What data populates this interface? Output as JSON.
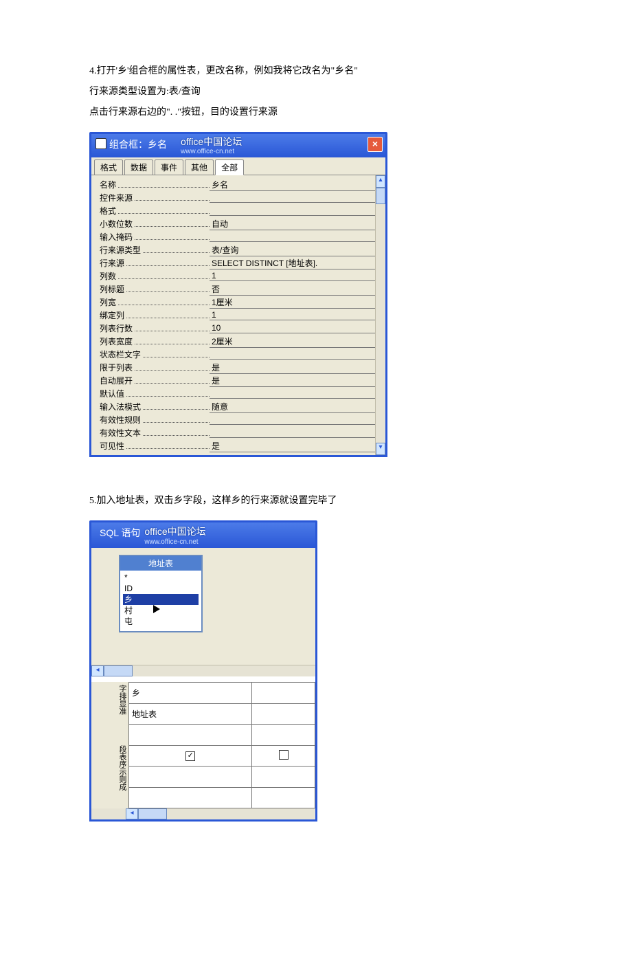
{
  "step4": {
    "line1": "4.打开'乡'组合框的属性表，更改名称，例如我将它改名为\"乡名\"",
    "line2": "行来源类型设置为:表/查询",
    "line3": "点击行来源右边的\". .\"按钮，目的设置行来源"
  },
  "prop_window": {
    "title_left": "组合框：乡名",
    "title_forum": "office中国论坛",
    "title_url": "www.office-cn.net",
    "close": "×",
    "tabs": [
      "格式",
      "数据",
      "事件",
      "其他",
      "全部"
    ],
    "active_tab_index": 4,
    "rows": [
      {
        "label": "名称",
        "value": "乡名"
      },
      {
        "label": "控件来源",
        "value": ""
      },
      {
        "label": "格式",
        "value": ""
      },
      {
        "label": "小数位数",
        "value": "自动"
      },
      {
        "label": "输入掩码",
        "value": ""
      },
      {
        "label": "行来源类型",
        "value": "表/查询"
      },
      {
        "label": "行来源",
        "value": "SELECT DISTINCT [地址表]."
      },
      {
        "label": "列数",
        "value": "1"
      },
      {
        "label": "列标题",
        "value": "否"
      },
      {
        "label": "列宽",
        "value": "1厘米"
      },
      {
        "label": "绑定列",
        "value": "1"
      },
      {
        "label": "列表行数",
        "value": "10"
      },
      {
        "label": "列表宽度",
        "value": "2厘米"
      },
      {
        "label": "状态栏文字",
        "value": ""
      },
      {
        "label": "限于列表",
        "value": "是"
      },
      {
        "label": "自动展开",
        "value": "是"
      },
      {
        "label": "默认值",
        "value": ""
      },
      {
        "label": "输入法模式",
        "value": "随意"
      },
      {
        "label": "有效性规则",
        "value": ""
      },
      {
        "label": "有效性文本",
        "value": ""
      },
      {
        "label": "可见性",
        "value": "是"
      }
    ]
  },
  "step5": {
    "line1": "5.加入地址表，双击乡字段，这样乡的行来源就设置完毕了"
  },
  "sql_window": {
    "title_left": "SQL 语句",
    "title_forum": "office中国论坛",
    "title_url": "www.office-cn.net",
    "table_title": "地址表",
    "fields": [
      "*",
      "ID",
      "乡",
      "村",
      "屯"
    ],
    "selected_field_index": 2,
    "row_labels": [
      "字排显准",
      "段表序示则成"
    ],
    "grid": [
      [
        "乡",
        ""
      ],
      [
        "地址表",
        ""
      ],
      [
        "",
        ""
      ],
      [
        "chk:true",
        "chk:false"
      ],
      [
        "",
        ""
      ],
      [
        "",
        ""
      ]
    ]
  }
}
